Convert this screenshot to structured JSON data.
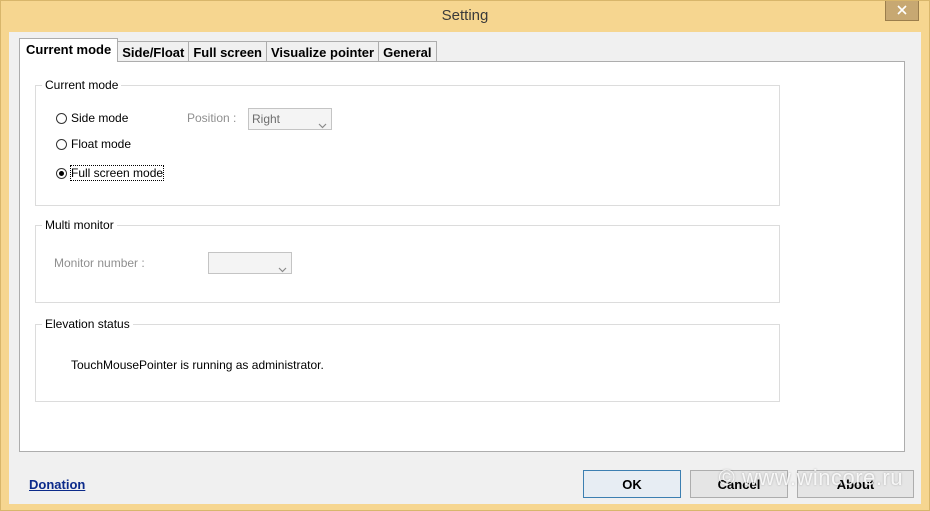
{
  "window": {
    "title": "Setting"
  },
  "tabs": [
    {
      "label": "Current mode",
      "active": true
    },
    {
      "label": "Side/Float",
      "active": false
    },
    {
      "label": "Full screen",
      "active": false
    },
    {
      "label": "Visualize pointer",
      "active": false
    },
    {
      "label": "General",
      "active": false
    }
  ],
  "current_mode": {
    "title": "Current mode",
    "options": [
      {
        "label": "Side mode",
        "checked": false
      },
      {
        "label": "Float mode",
        "checked": false
      },
      {
        "label": "Full screen mode",
        "checked": true
      }
    ],
    "position_label": "Position :",
    "position_value": "Right"
  },
  "multi_monitor": {
    "title": "Multi monitor",
    "monitor_label": "Monitor number :",
    "monitor_value": ""
  },
  "elevation": {
    "title": "Elevation status",
    "text": "TouchMousePointer is running as administrator."
  },
  "footer": {
    "donation": "Donation",
    "ok": "OK",
    "cancel": "Cancel",
    "about": "About"
  },
  "watermark": "© www.wincore.ru"
}
